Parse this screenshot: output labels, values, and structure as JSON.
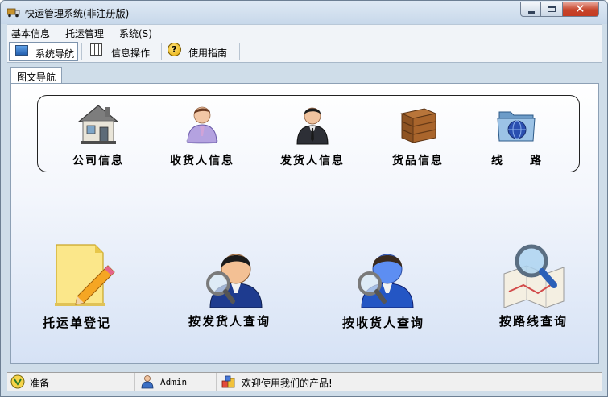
{
  "window": {
    "title": "快运管理系统(非注册版)"
  },
  "menubar": {
    "items": [
      "基本信息",
      "托运管理",
      "系统(S)"
    ]
  },
  "toolbar": {
    "tabs": [
      {
        "label": "系统导航",
        "icon": "monitor-icon",
        "active": true
      },
      {
        "label": "信息操作",
        "icon": "grid-icon"
      },
      {
        "label": "使用指南",
        "icon": "help-icon"
      }
    ]
  },
  "page_tab": {
    "label": "图文导航"
  },
  "nav": {
    "items": [
      {
        "label": "公司信息",
        "icon": "house-icon"
      },
      {
        "label": "收货人信息",
        "icon": "receiver-person-icon"
      },
      {
        "label": "发货人信息",
        "icon": "sender-person-icon"
      },
      {
        "label": "货品信息",
        "icon": "crate-icon"
      },
      {
        "label": "线　　路",
        "icon": "globe-folder-icon"
      }
    ]
  },
  "actions": {
    "items": [
      {
        "label": "托运单登记",
        "icon": "notepad-pencil-icon"
      },
      {
        "label": "按发货人查询",
        "icon": "person-magnifier-icon"
      },
      {
        "label": "按收货人查询",
        "icon": "person-magnifier-blue-icon"
      },
      {
        "label": "按路线查询",
        "icon": "map-magnifier-icon"
      }
    ]
  },
  "statusbar": {
    "ready": "准备",
    "user": "Admin",
    "message": "欢迎使用我们的产品!"
  },
  "colors": {
    "window_frame": "#cfdde9",
    "close_button": "#c6442a",
    "content_gradient_end": "#d6e2f5"
  }
}
